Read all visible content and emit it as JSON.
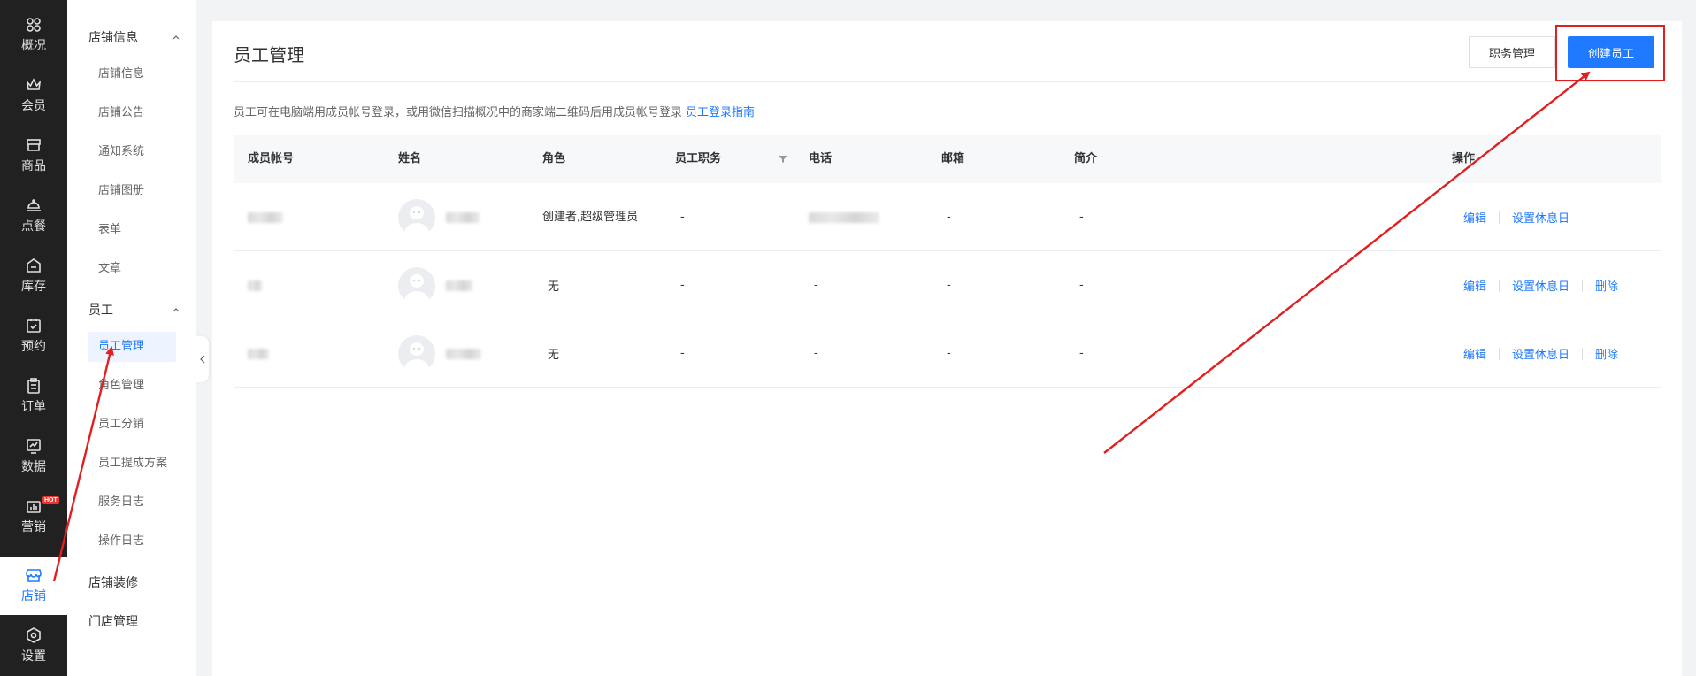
{
  "nav": {
    "items": [
      {
        "label": "概况",
        "icon": "grid-icon"
      },
      {
        "label": "会员",
        "icon": "crown-icon"
      },
      {
        "label": "商品",
        "icon": "box-icon"
      },
      {
        "label": "点餐",
        "icon": "food-cover-icon"
      },
      {
        "label": "库存",
        "icon": "warehouse-icon"
      },
      {
        "label": "预约",
        "icon": "calendar-check-icon"
      },
      {
        "label": "订单",
        "icon": "clipboard-icon"
      },
      {
        "label": "数据",
        "icon": "chart-icon"
      },
      {
        "label": "营销",
        "icon": "marketing-icon",
        "badge": "HOT"
      },
      {
        "label": "店铺",
        "icon": "shop-icon",
        "active": true
      },
      {
        "label": "设置",
        "icon": "settings-icon"
      }
    ]
  },
  "sidebar": {
    "groups": [
      {
        "label": "店铺信息",
        "items": [
          "店铺信息",
          "店铺公告",
          "通知系统",
          "店铺图册",
          "表单",
          "文章"
        ]
      },
      {
        "label": "员工",
        "items": [
          "员工管理",
          "角色管理",
          "员工分销",
          "员工提成方案",
          "服务日志",
          "操作日志"
        ]
      }
    ],
    "links": [
      "店铺装修",
      "门店管理"
    ],
    "active_item": "员工管理"
  },
  "page": {
    "title": "员工管理",
    "position_button": "职务管理",
    "create_button": "创建员工",
    "hint": "员工可在电脑端用成员帐号登录，或用微信扫描概况中的商家端二维码后用成员帐号登录",
    "hint_link": "员工登录指南"
  },
  "table": {
    "headers": [
      "成员帐号",
      "姓名",
      "角色",
      "员工职务",
      "电话",
      "邮箱",
      "简介",
      "操作"
    ],
    "rows": [
      {
        "role": "创建者,超级管理员",
        "position": "-",
        "email": "-",
        "intro": "-",
        "actions": [
          "编辑",
          "设置休息日"
        ]
      },
      {
        "role": "无",
        "position": "-",
        "phone": "-",
        "email": "-",
        "intro": "-",
        "actions": [
          "编辑",
          "设置休息日",
          "删除"
        ]
      },
      {
        "role": "无",
        "position": "-",
        "phone": "-",
        "email": "-",
        "intro": "-",
        "actions": [
          "编辑",
          "设置休息日",
          "删除"
        ]
      }
    ]
  },
  "colors": {
    "accent": "#1f7aff",
    "nav_bg": "#212121",
    "annotation": "#e02020"
  }
}
